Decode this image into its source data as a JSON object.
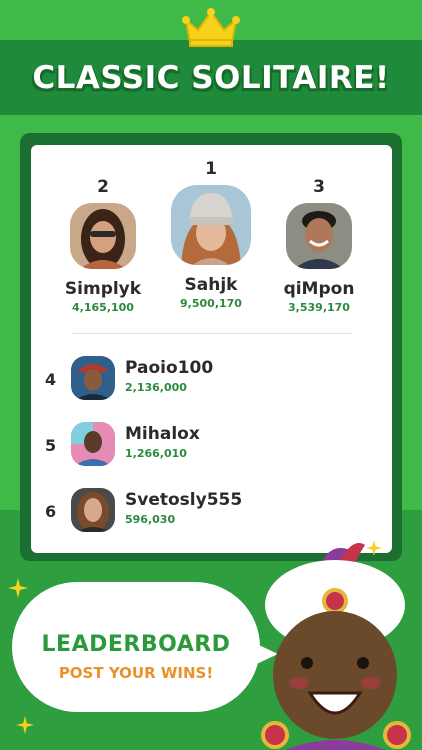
{
  "header": {
    "title": "CLASSIC SOLITAIRE!",
    "crown_icon": "crown-icon"
  },
  "podium": [
    {
      "rank": "2",
      "name": "Simplyk",
      "score": "4,165,100"
    },
    {
      "rank": "1",
      "name": "Sahjk",
      "score": "9,500,170"
    },
    {
      "rank": "3",
      "name": "qiMpon",
      "score": "3,539,170"
    }
  ],
  "list": [
    {
      "rank": "4",
      "name": "Paoio100",
      "score": "2,136,000"
    },
    {
      "rank": "5",
      "name": "Mihalox",
      "score": "1,266,010"
    },
    {
      "rank": "6",
      "name": "Svetosly555",
      "score": "596,030"
    }
  ],
  "promo": {
    "title": "LEADERBOARD",
    "subtitle": "POST YOUR WINS!"
  },
  "colors": {
    "background": "#3fb948",
    "banner": "#1f8a3a",
    "score_green": "#2b8a3e",
    "accent_orange": "#e8922a"
  }
}
